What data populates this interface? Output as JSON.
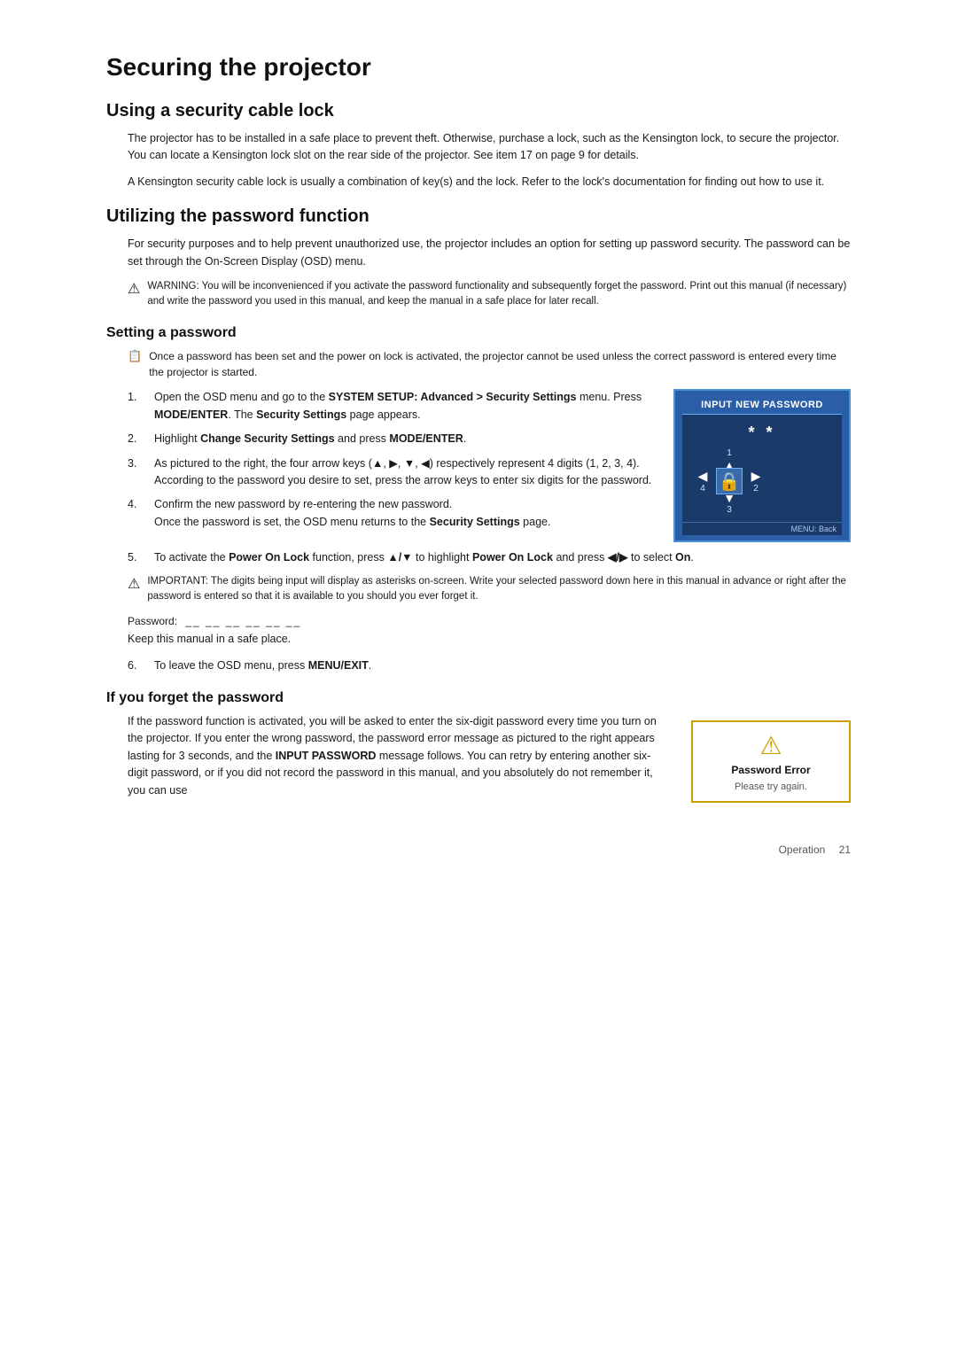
{
  "page": {
    "title": "Securing the projector",
    "sections": [
      {
        "id": "cable-lock",
        "title": "Using a security cable lock",
        "paragraphs": [
          "The projector has to be installed in a safe place to prevent theft. Otherwise, purchase a lock, such as the Kensington lock, to secure the projector. You can locate a Kensington lock slot on the rear side of the projector. See item 17 on page 9 for details.",
          "A Kensington security cable lock is usually a combination of key(s) and the lock. Refer to the lock's documentation for finding out how to use it."
        ]
      },
      {
        "id": "password-function",
        "title": "Utilizing the password function",
        "paragraphs": [
          "For security purposes and to help prevent unauthorized use, the projector includes an option for setting up password security. The password can be set through the On-Screen Display (OSD) menu."
        ],
        "warning": "WARNING: You will be inconvenienced if you activate the password functionality and subsequently forget the password. Print out this manual (if necessary) and write the password you used in this manual, and keep the manual in a safe place for later recall."
      },
      {
        "id": "setting-password",
        "subsection": "Setting a password",
        "note": "Once a password has been set and the power on lock is activated, the projector cannot be used unless the correct password is entered every time the projector is started.",
        "steps": [
          {
            "num": "1.",
            "text": "Open the OSD menu and go to the SYSTEM SETUP: Advanced > Security Settings menu. Press MODE/ENTER. The Security Settings page appears."
          },
          {
            "num": "2.",
            "text": "Highlight Change Security Settings and press MODE/ENTER."
          },
          {
            "num": "3.",
            "text": "As pictured to the right, the four arrow keys (▲, ▶, ▼, ◀) respectively represent 4 digits (1, 2, 3, 4). According to the password you desire to set, press the arrow keys to enter six digits for the password."
          },
          {
            "num": "4.",
            "text": "Confirm the new password by re-entering the new password. Once the password is set, the OSD menu returns to the Security Settings page."
          },
          {
            "num": "5.",
            "text": "To activate the Power On Lock function, press ▲/▼ to highlight Power On Lock and press ◀/▶ to select On."
          }
        ],
        "important": "IMPORTANT: The digits being input will display as asterisks on-screen. Write your selected password down here in this manual in advance or right after the password is entered so that it is available to you should you ever forget it.",
        "password_label": "Password:",
        "password_blanks": "__ __ __ __ __ __",
        "keep_manual": "Keep this manual in a safe place.",
        "step6": {
          "num": "6.",
          "text": "To leave the OSD menu, press MENU/EXIT."
        },
        "osd": {
          "title": "INPUT NEW PASSWORD",
          "asterisks": "* *",
          "arrows": {
            "top": "1",
            "right": "2",
            "bottom": "3",
            "left": "4"
          },
          "footer": "MENU: Back"
        }
      },
      {
        "id": "forget-password",
        "subsection": "If you forget the password",
        "paragraphs": [
          "If the password function is activated, you will be asked to enter the six-digit password every time you turn on the projector. If you enter the wrong password, the password error message as pictured to the right appears lasting for 3 seconds, and the INPUT PASSWORD message follows. You can retry by entering another six-digit password, or if you did not record the password in this manual, and you absolutely do not remember it, you can use"
        ],
        "error_box": {
          "title": "Password Error",
          "subtitle": "Please try again."
        }
      }
    ],
    "footer": {
      "label": "Operation",
      "page": "21"
    }
  }
}
